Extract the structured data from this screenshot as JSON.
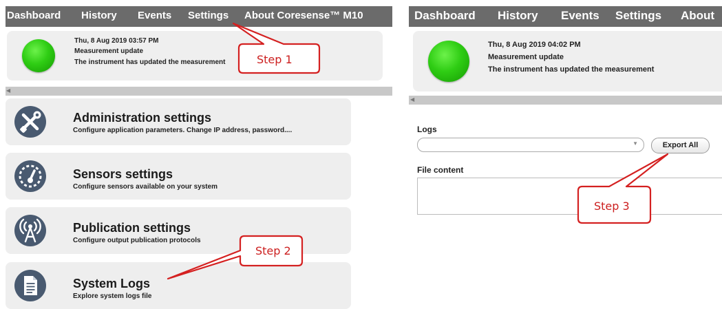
{
  "left_screen": {
    "nav": [
      "Dashboard",
      "History",
      "Events",
      "Settings",
      "About Coresense™ M10"
    ],
    "notification": {
      "timestamp": "Thu, 8 Aug 2019 03:57 PM",
      "title": "Measurement update",
      "message": "The instrument has updated the measurement"
    },
    "menu": [
      {
        "icon": "tools-icon",
        "title": "Administration settings",
        "desc": "Configure application parameters. Change IP address, password...."
      },
      {
        "icon": "gauge-icon",
        "title": "Sensors settings",
        "desc": "Configure sensors available on your system"
      },
      {
        "icon": "antenna-icon",
        "title": "Publication settings",
        "desc": "Configure output publication protocols"
      },
      {
        "icon": "document-icon",
        "title": "System Logs",
        "desc": "Explore system logs file"
      }
    ]
  },
  "right_screen": {
    "nav": [
      "Dashboard",
      "History",
      "Events",
      "Settings",
      "About"
    ],
    "notification": {
      "timestamp": "Thu, 8 Aug 2019 04:02 PM",
      "title": "Measurement update",
      "message": "The instrument has updated the measurement"
    },
    "logs_label": "Logs",
    "logs_select_value": "",
    "export_button": "Export All",
    "file_content_label": "File content",
    "file_content_value": ""
  },
  "callouts": {
    "step1": "Step 1",
    "step2": "Step 2",
    "step3": "Step 3",
    "color": "#d42020"
  },
  "colors": {
    "nav_bg": "#6b6b6b",
    "status_green": "#2fcd14",
    "icon_bg": "#495a70"
  }
}
